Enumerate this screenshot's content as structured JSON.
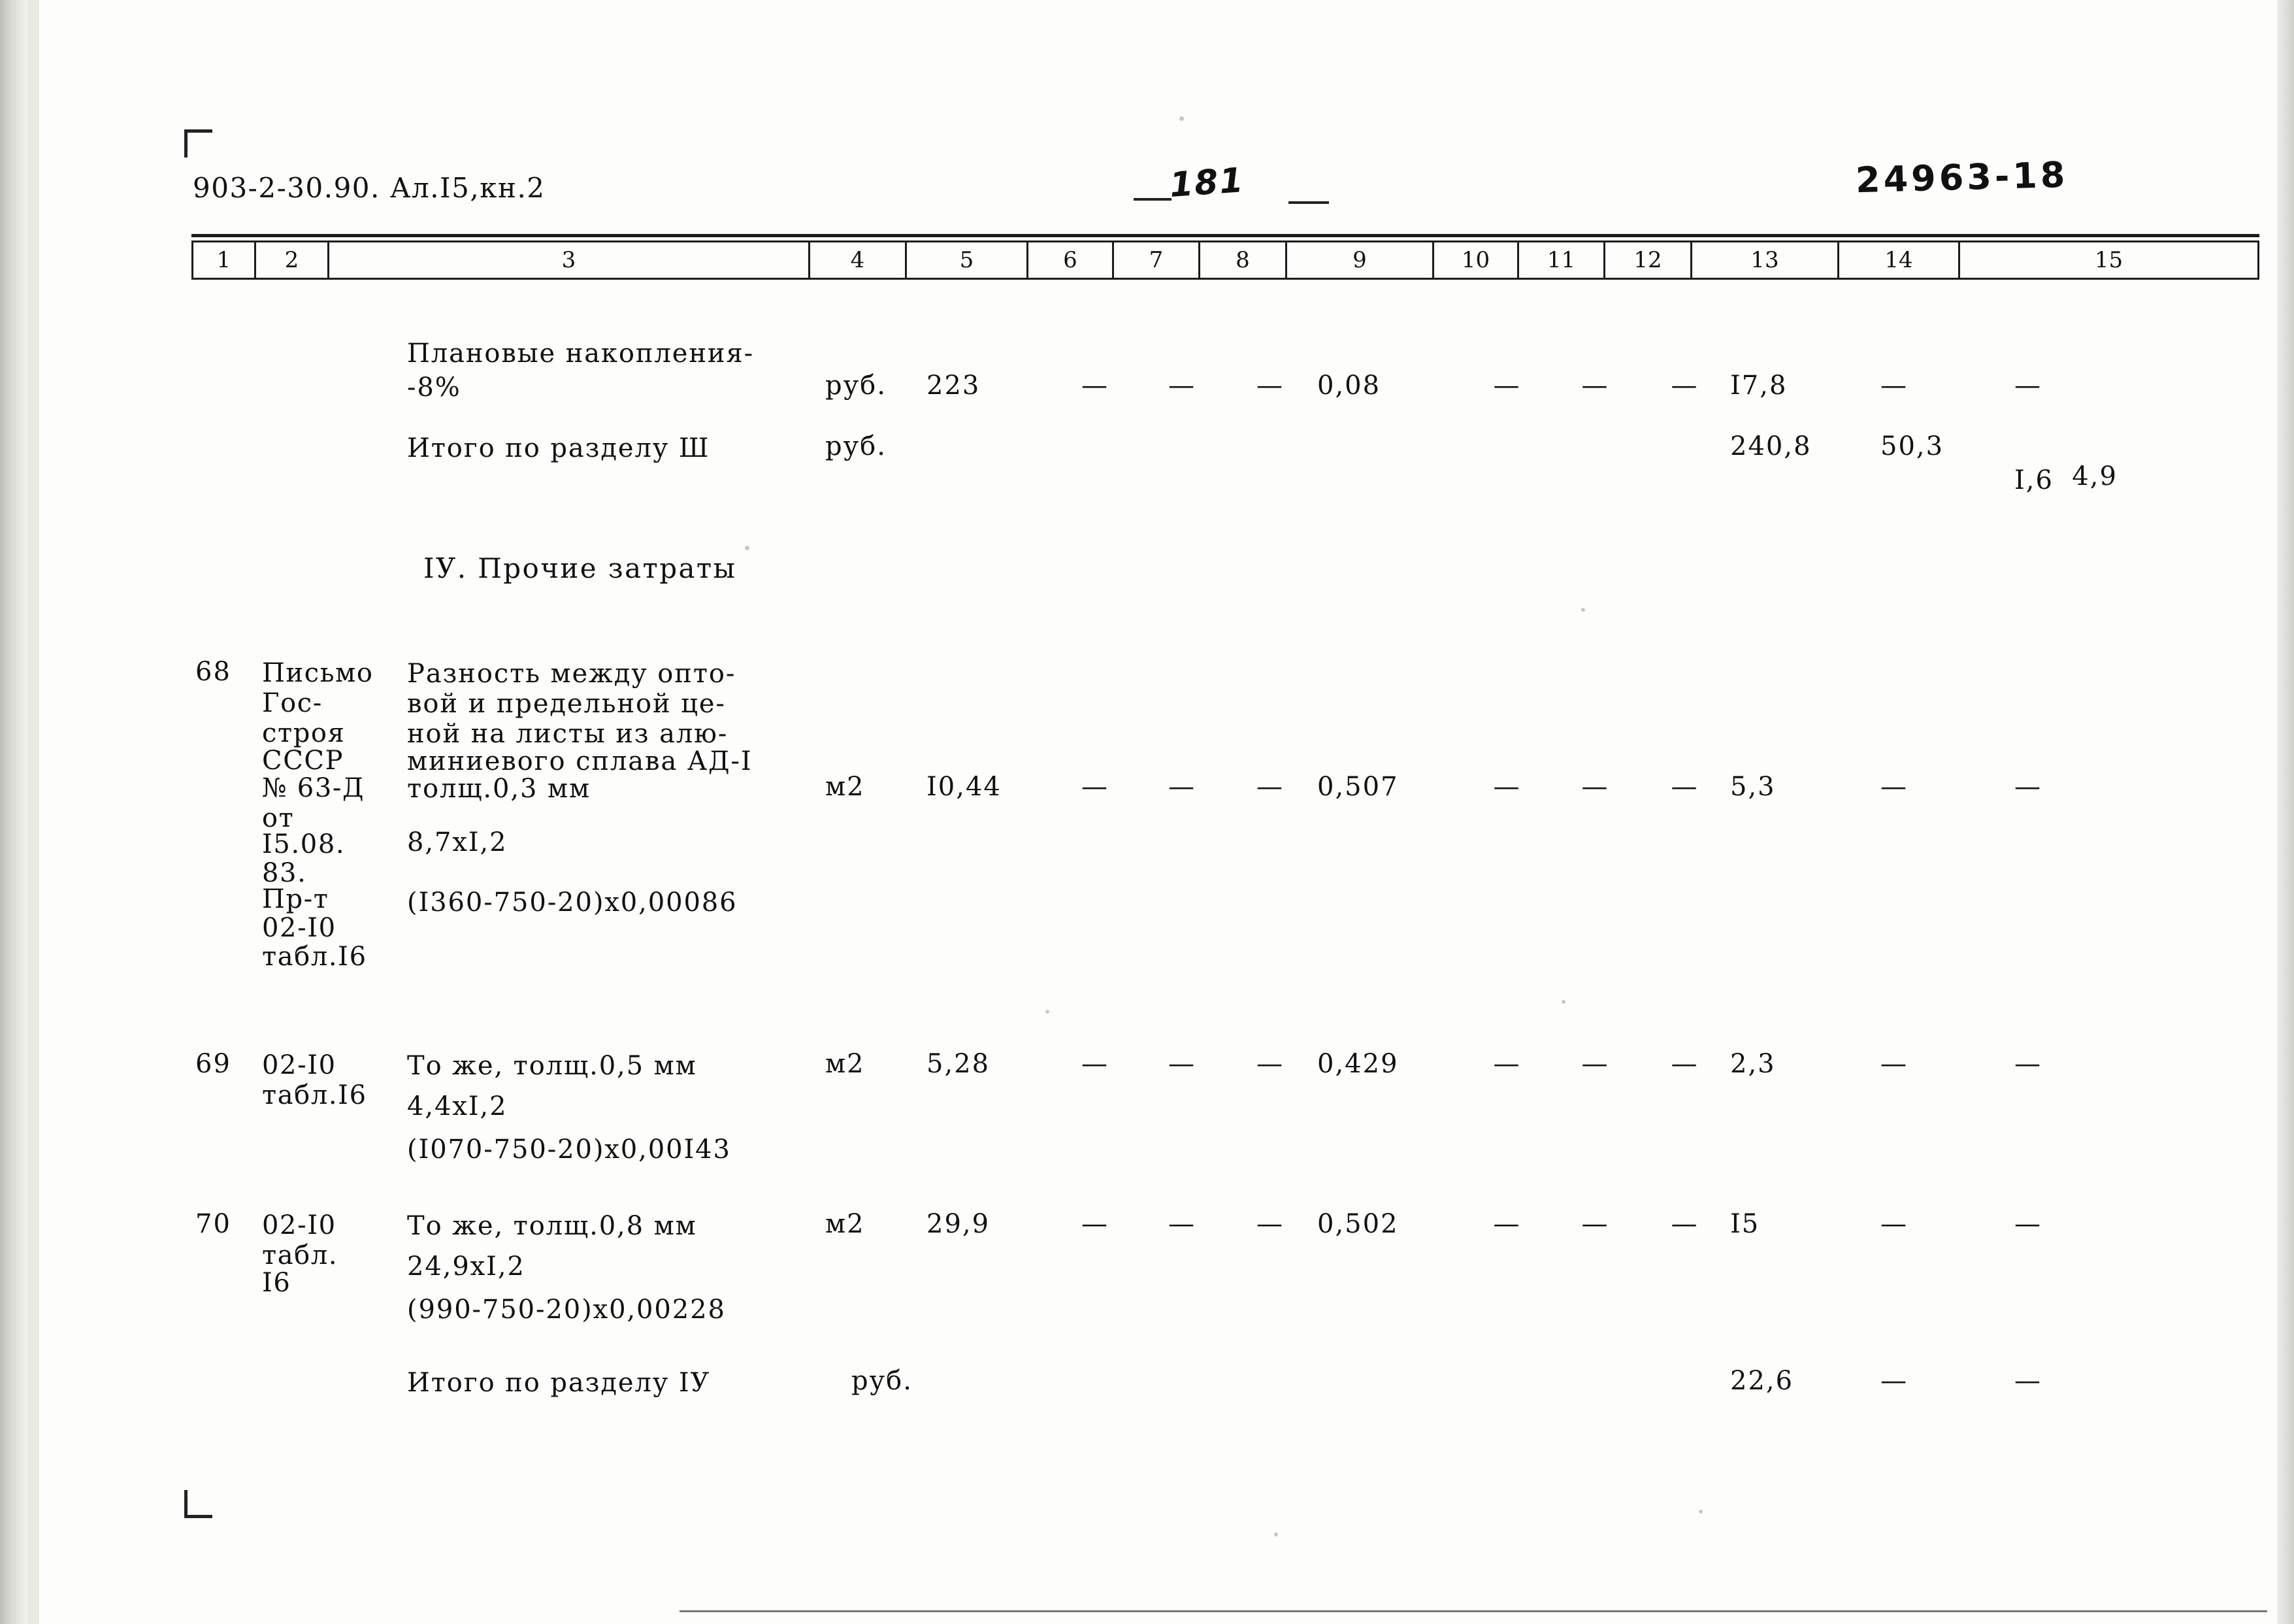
{
  "header": {
    "doc_code": "903-2-30.90. Ал.I5,кн.2",
    "page_number": "181",
    "archive_code": "24963-18"
  },
  "table": {
    "column_numbers": [
      "1",
      "2",
      "3",
      "4",
      "5",
      "6",
      "7",
      "8",
      "9",
      "10",
      "11",
      "12",
      "13",
      "14",
      "15"
    ],
    "rows": [
      {
        "id": "row-planovye-nakopleniya",
        "num": "",
        "ref": "",
        "desc_line1": "Плановые накопления-",
        "desc_line2": "-8%",
        "unit": "руб.",
        "c5": "223",
        "c6": "—",
        "c7": "—",
        "c8": "—",
        "c9": "0,08",
        "c10": "—",
        "c11": "—",
        "c12": "—",
        "c13": "I7,8",
        "c14": "—",
        "c15": "—"
      },
      {
        "id": "row-itogo-razdel-3",
        "num": "",
        "ref": "",
        "desc_line1": "Итого по разделу Ш",
        "unit": "руб.",
        "c13": "240,8",
        "c14": "50,3",
        "c15_top": "4,9",
        "c15_bottom": "I,6"
      },
      {
        "id": "row-68",
        "num": "68",
        "ref_lines": [
          "Письмо",
          "Гос-",
          "строя",
          "СССР",
          "№ 63-Д",
          "от",
          "I5.08.",
          "83.",
          "Пр-т",
          "02-I0",
          "табл.I6"
        ],
        "desc_lines": [
          "Разность между опто-",
          "вой и предельной це-",
          "ной на листы из алю-",
          "миниевого сплава АД-I",
          "толщ.0,3 мм"
        ],
        "desc_extra1": "8,7xI,2",
        "desc_extra2": "(I360-750-20)x0,00086",
        "unit": "м2",
        "c5": "I0,44",
        "c6": "—",
        "c7": "—",
        "c8": "—",
        "c9": "0,507",
        "c10": "—",
        "c11": "—",
        "c12": "—",
        "c13": "5,3",
        "c14": "—",
        "c15": "—"
      },
      {
        "id": "row-69",
        "num": "69",
        "ref_lines": [
          "02-I0",
          "табл.I6"
        ],
        "desc_lines": [
          "То же, толщ.0,5 мм"
        ],
        "desc_extra1": "4,4xI,2",
        "desc_extra2": "(I070-750-20)x0,00I43",
        "unit": "м2",
        "c5": "5,28",
        "c6": "—",
        "c7": "—",
        "c8": "—",
        "c9": "0,429",
        "c10": "—",
        "c11": "—",
        "c12": "—",
        "c13": "2,3",
        "c14": "—",
        "c15": "—"
      },
      {
        "id": "row-70",
        "num": "70",
        "ref_lines": [
          "02-I0",
          "табл.",
          "I6"
        ],
        "desc_lines": [
          "То же, толщ.0,8 мм"
        ],
        "desc_extra1": "24,9xI,2",
        "desc_extra2": "(990-750-20)x0,00228",
        "unit": "м2",
        "c5": "29,9",
        "c6": "—",
        "c7": "—",
        "c8": "—",
        "c9": "0,502",
        "c10": "—",
        "c11": "—",
        "c12": "—",
        "c13": "I5",
        "c14": "—",
        "c15": "—"
      },
      {
        "id": "row-itogo-razdel-4",
        "num": "",
        "ref": "",
        "desc_line1": "Итого по разделу IУ",
        "unit": "руб.",
        "c13": "22,6",
        "c14": "—",
        "c15": "—"
      }
    ]
  },
  "section_heading": "IУ. Прочие затраты"
}
